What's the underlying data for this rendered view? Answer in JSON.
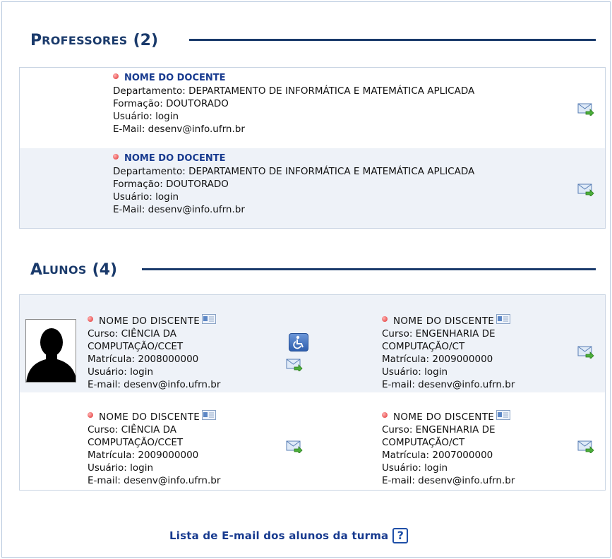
{
  "professores": {
    "title_first": "P",
    "title_rest": "ROFESSORES",
    "count": "(2)",
    "items": [
      {
        "name": "NOME DO DOCENTE",
        "departamento": "Departamento: DEPARTAMENTO DE INFORMÁTICA E MATEMÁTICA APLICADA",
        "formacao": "Formação: DOUTORADO",
        "usuario": "Usuário: login",
        "email": "E-Mail: desenv@info.ufrn.br"
      },
      {
        "name": "NOME DO DOCENTE",
        "departamento": "Departamento: DEPARTAMENTO DE INFORMÁTICA E MATEMÁTICA APLICADA",
        "formacao": "Formação: DOUTORADO",
        "usuario": "Usuário: login",
        "email": "E-Mail: desenv@info.ufrn.br"
      }
    ]
  },
  "alunos": {
    "title_first": "A",
    "title_rest": "LUNOS",
    "count": "(4)",
    "items": [
      {
        "name": "NOME DO DISCENTE",
        "curso1": "Curso: CIÊNCIA DA",
        "curso2": "COMPUTAÇÃO/CCET",
        "matricula": "Matrícula: 2008000000",
        "usuario": "Usuário: login",
        "email": "E-mail: desenv@info.ufrn.br"
      },
      {
        "name": "NOME DO DISCENTE",
        "curso1": "Curso: ENGENHARIA DE",
        "curso2": "COMPUTAÇÃO/CT",
        "matricula": "Matrícula: 2009000000",
        "usuario": "Usuário: login",
        "email": "E-mail: desenv@info.ufrn.br"
      },
      {
        "name": "NOME DO DISCENTE",
        "curso1": "Curso: CIÊNCIA DA",
        "curso2": "COMPUTAÇÃO/CCET",
        "matricula": "Matrícula: 2009000000",
        "usuario": "Usuário: login",
        "email": "E-mail: desenv@info.ufrn.br"
      },
      {
        "name": "NOME DO DISCENTE",
        "curso1": "Curso: ENGENHARIA DE",
        "curso2": "COMPUTAÇÃO/CT",
        "matricula": "Matrícula: 2007000000",
        "usuario": "Usuário: login",
        "email": "E-mail: desenv@info.ufrn.br"
      }
    ]
  },
  "footer": {
    "link_label": "Lista de E-mail dos alunos da turma",
    "help_symbol": "?"
  },
  "icons": {
    "status_dot": "red-dot-icon",
    "mail": "send-mail-icon",
    "card": "id-card-icon",
    "accessibility": "wheelchair-icon",
    "help": "help-icon"
  },
  "colors": {
    "title": "#1a3a6b",
    "link": "#173a8f",
    "row_alt": "#eef2f8",
    "dot": "#e03030"
  }
}
